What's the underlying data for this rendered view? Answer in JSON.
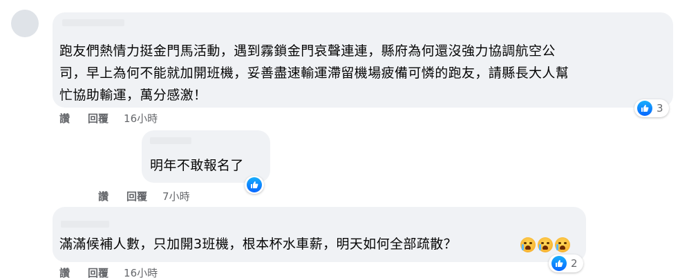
{
  "comments": [
    {
      "text_lines": [
        "跑友們熱情力挺金門馬活動，遇到霧鎖金門哀聲連連，縣府為何還沒強力協調航空公",
        "司，早上為何不能就加開班機，妥善盡速輸運滯留機場疲備可憐的跑友，請縣長大人幫",
        "忙協助輸運，萬分感激！"
      ],
      "actions": {
        "like": "讚",
        "reply": "回覆",
        "time": "16小時"
      },
      "reaction": {
        "icon": "like-icon",
        "count": "3"
      }
    },
    {
      "text_lines": [
        "明年不敢報名了"
      ],
      "actions": {
        "like": "讚",
        "reply": "回覆",
        "time": "7小時"
      },
      "reaction": {
        "icon": "like-icon",
        "count": ""
      }
    },
    {
      "text_lines": [
        "滿滿候補人數，只加開3班機，根本杯水車薪，明天如何全部疏散？"
      ],
      "emojis": [
        "crying-face-icon",
        "crying-face-icon",
        "crying-face-icon"
      ],
      "actions": {
        "like": "讚",
        "reply": "回覆",
        "time": "16小時"
      },
      "reaction": {
        "icon": "like-icon",
        "count": "2"
      }
    }
  ],
  "colors": {
    "bubble": "#f0f2f5",
    "meta": "#65676b",
    "like": "#0866ff"
  }
}
